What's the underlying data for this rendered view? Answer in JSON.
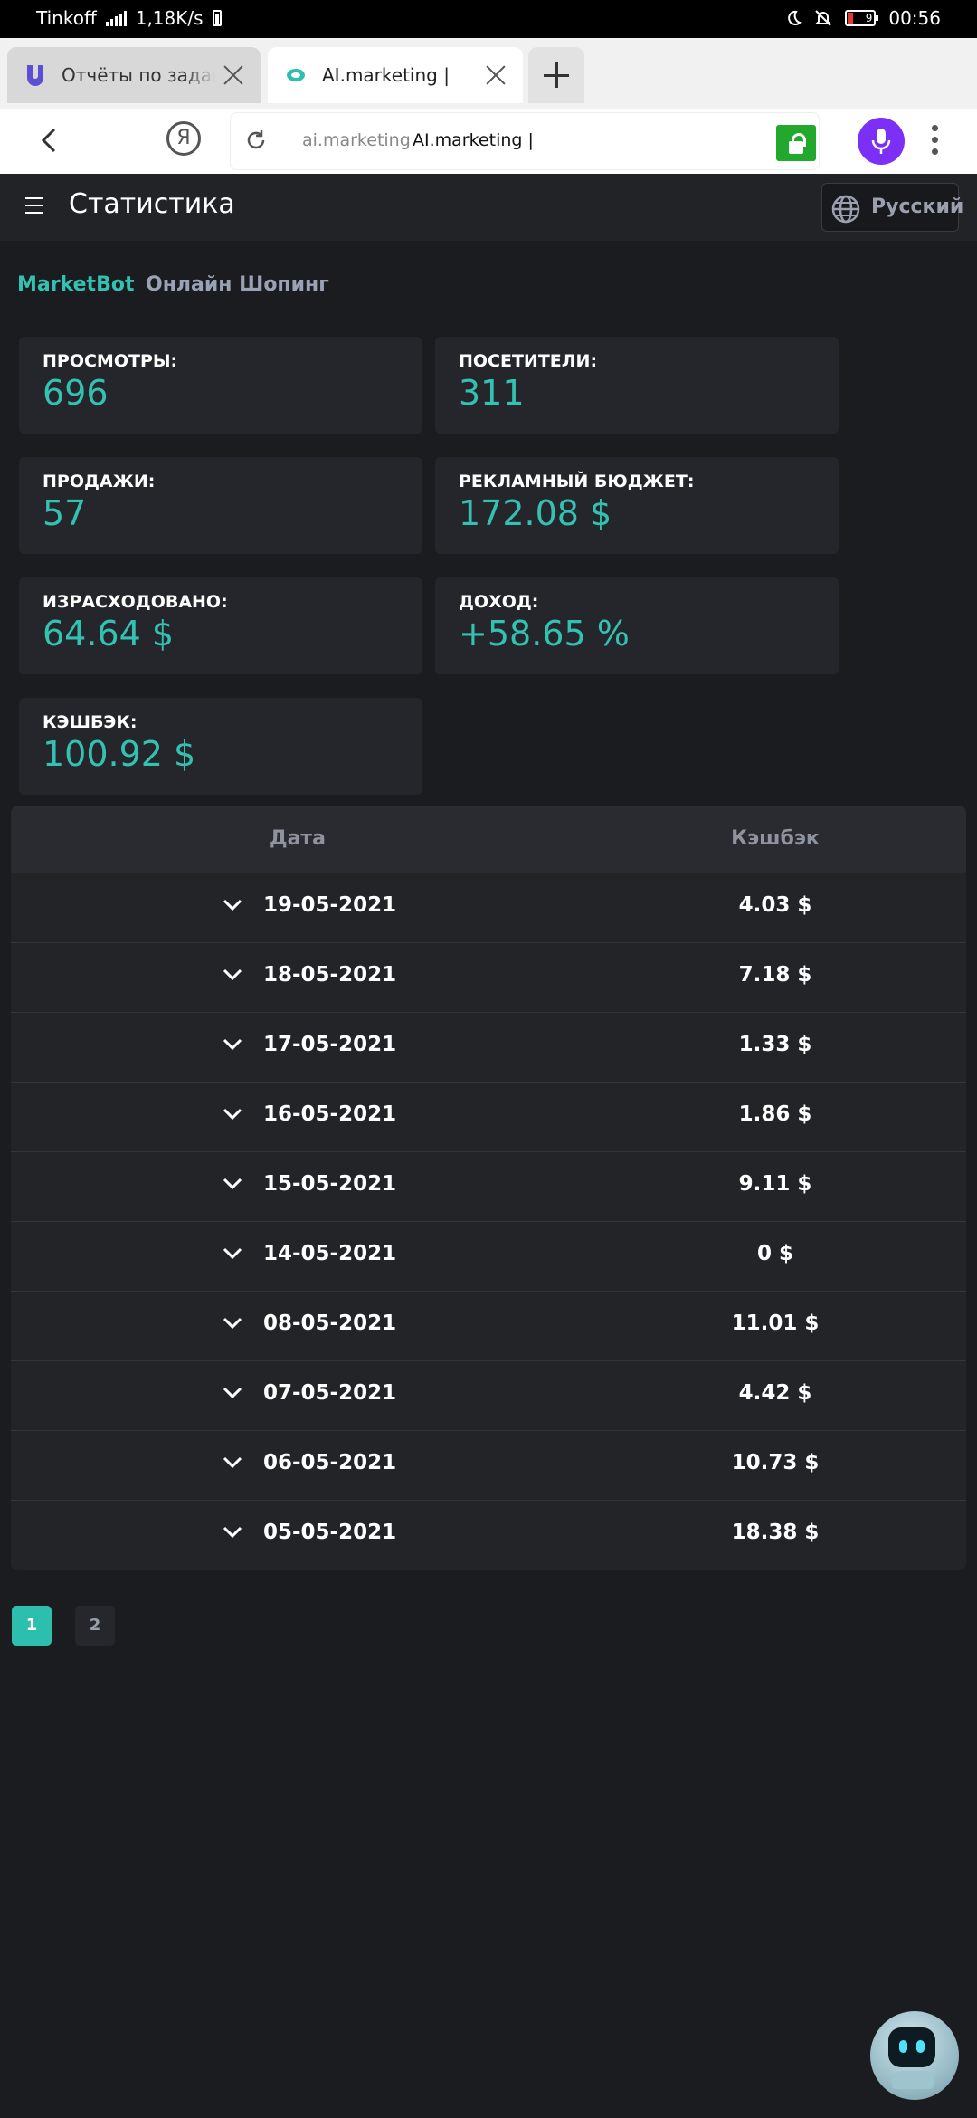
{
  "status_bar": {
    "carrier": "Tinkoff",
    "network_speed": "1,18K/s",
    "battery_level": "9",
    "time": "00:56"
  },
  "browser": {
    "tabs": [
      {
        "label": "Отчёты по заданиям",
        "active": false
      },
      {
        "label": "AI.marketing |",
        "active": true
      }
    ],
    "address_domain": "ai.marketing",
    "address_title": "AI.marketing |",
    "yandex_label": "Я"
  },
  "header": {
    "title": "Статистика",
    "language": "Русский"
  },
  "shop_tabs": [
    {
      "label": "MarketBot",
      "active": true
    },
    {
      "label": "Онлайн Шопинг",
      "active": false
    }
  ],
  "stats": [
    {
      "label": "ПРОСМОТРЫ:",
      "value": "696"
    },
    {
      "label": "ПОСЕТИТЕЛИ:",
      "value": "311"
    },
    {
      "label": "ПРОДАЖИ:",
      "value": "57"
    },
    {
      "label": "РЕКЛАМНЫЙ БЮДЖЕТ:",
      "value": "172.08 $"
    },
    {
      "label": "ИЗРАСХОДОВАНО:",
      "value": "64.64 $"
    },
    {
      "label": "ДОХОД:",
      "value": "+58.65 %"
    },
    {
      "label": "КЭШБЭК:",
      "value": "100.92 $"
    }
  ],
  "table": {
    "columns": [
      "Дата",
      "Кэшбэк"
    ],
    "rows": [
      {
        "date": "19-05-2021",
        "cashback": "4.03 $"
      },
      {
        "date": "18-05-2021",
        "cashback": "7.18 $"
      },
      {
        "date": "17-05-2021",
        "cashback": "1.33 $"
      },
      {
        "date": "16-05-2021",
        "cashback": "1.86 $"
      },
      {
        "date": "15-05-2021",
        "cashback": "9.11 $"
      },
      {
        "date": "14-05-2021",
        "cashback": "0 $"
      },
      {
        "date": "08-05-2021",
        "cashback": "11.01 $"
      },
      {
        "date": "07-05-2021",
        "cashback": "4.42 $"
      },
      {
        "date": "06-05-2021",
        "cashback": "10.73 $"
      },
      {
        "date": "05-05-2021",
        "cashback": "18.38 $"
      }
    ]
  },
  "pagination": {
    "pages": [
      "1",
      "2"
    ],
    "current": "1"
  },
  "colors": {
    "accent": "#33c1b1",
    "background": "#1b1c20",
    "card": "#25262b"
  },
  "icons": [
    "moon-icon",
    "mute-icon",
    "battery-icon",
    "signal-icon",
    "globe-icon",
    "menu-icon",
    "chevron-down-icon",
    "microphone-icon",
    "lock-icon",
    "reload-icon",
    "back-icon",
    "close-icon",
    "plus-icon",
    "chat-bot-icon"
  ]
}
